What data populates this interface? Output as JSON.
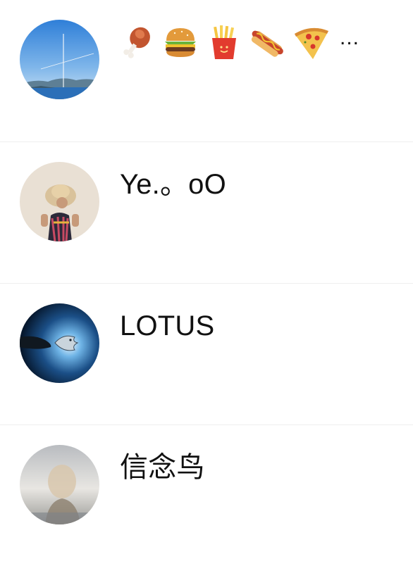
{
  "contacts": [
    {
      "name_icons": [
        "meat-on-bone-icon",
        "hamburger-icon",
        "french-fries-icon",
        "hot-dog-icon",
        "pizza-icon"
      ],
      "name_suffix": "...",
      "avatar": "seaside-landscape-avatar"
    },
    {
      "name": "Ye.。oO",
      "avatar": "person-with-hat-avatar"
    },
    {
      "name": "LOTUS",
      "avatar": "hand-and-fish-avatar"
    },
    {
      "name": "信念鸟",
      "avatar": "hazy-figure-avatar"
    }
  ],
  "colors": {
    "background": "#ffffff",
    "divider": "#eeeeee",
    "text": "#111111"
  }
}
